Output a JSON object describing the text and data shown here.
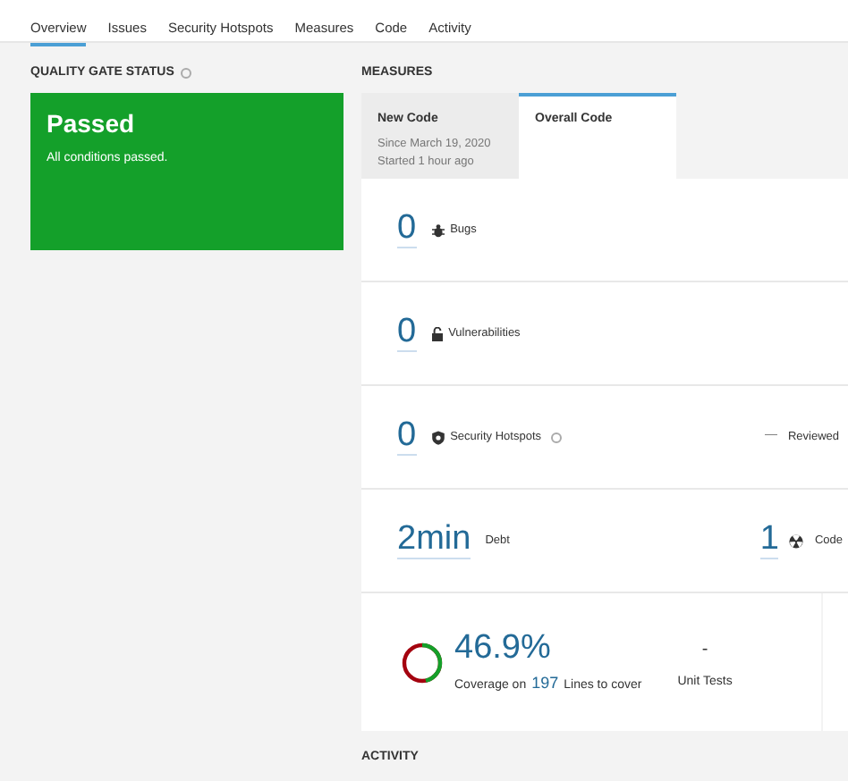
{
  "nav_tabs": [
    {
      "label": "Overview",
      "selected": true
    },
    {
      "label": "Issues",
      "selected": false
    },
    {
      "label": "Security Hotspots",
      "selected": false
    },
    {
      "label": "Measures",
      "selected": false
    },
    {
      "label": "Code",
      "selected": false
    },
    {
      "label": "Activity",
      "selected": false
    }
  ],
  "quality_gate": {
    "heading": "QUALITY GATE STATUS",
    "status": "Passed",
    "message": "All conditions passed."
  },
  "measures": {
    "heading": "MEASURES",
    "period_tabs": [
      {
        "title": "New Code",
        "lines": [
          "Since March 19, 2020",
          "Started 1 hour ago"
        ],
        "selected": false
      },
      {
        "title": "Overall Code",
        "selected": true
      }
    ],
    "rows": [
      {
        "kind": "bugs",
        "value": "0",
        "label": "Bugs"
      },
      {
        "kind": "vulnerabilities",
        "value": "0",
        "label": "Vulnerabilities"
      },
      {
        "kind": "hotspots",
        "value": "0",
        "label": "Security Hotspots",
        "help": true,
        "right_value": "—",
        "right_label": "Reviewed"
      },
      {
        "kind": "debt",
        "value": "2min",
        "label": "Debt",
        "right_value": "1",
        "right_icon": true,
        "right_label": "Code"
      }
    ],
    "coverage": {
      "level": 0.469,
      "value": "46.9%",
      "caption_before": "Coverage on",
      "lines": "197",
      "caption_after": "Lines to cover",
      "tests_value": "-",
      "tests_label": "Unit Tests"
    }
  },
  "activity": {
    "heading": "ACTIVITY"
  }
}
